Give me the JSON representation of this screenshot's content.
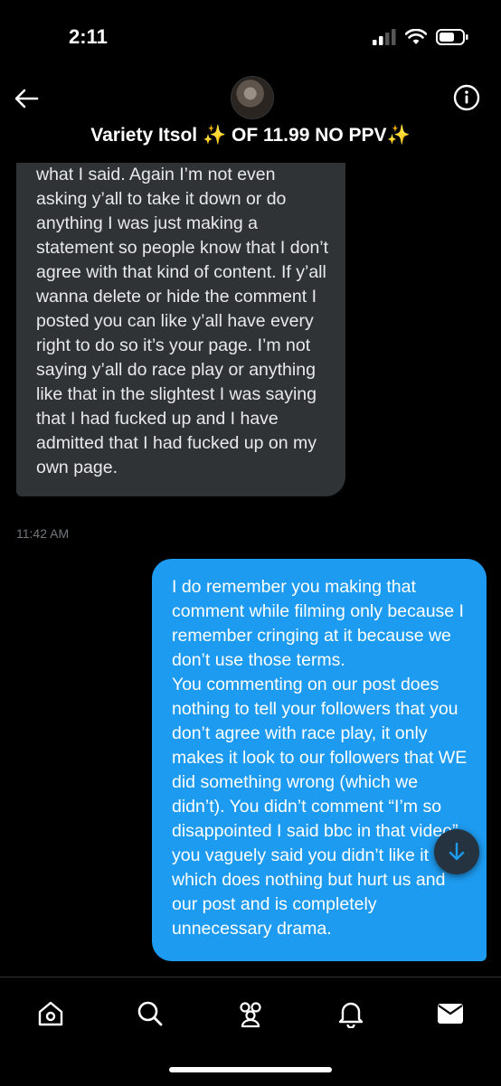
{
  "status_bar": {
    "time": "2:11"
  },
  "header": {
    "title_text": "Variety Itsol",
    "title_sparkle_left": "✨",
    "title_offer": "OF 11.99 NO PPV",
    "title_sparkle_right": "✨",
    "icons": {
      "back": "back-arrow-icon",
      "info": "info-icon"
    }
  },
  "messages": {
    "incoming": {
      "text": "what I said. Again I’m not even asking y’all to take it down or do anything I was just making a statement so people know that I don’t agree with that kind of content. If y’all wanna delete or hide the comment I posted you can like y’all have every right to do so it’s your page. I’m not saying y’all do race play or anything like that in the slightest I was saying that I had fucked up and I have admitted that I had fucked up on my own page.",
      "time": "11:42 AM"
    },
    "outgoing": {
      "paragraph1": "I do remember you making that comment while filming only because I remember cringing at it because we don’t use those terms.",
      "paragraph2": "You commenting on our post does nothing to tell your followers that you don’t agree with race play, it only makes it look to our followers that WE did something wrong (which we didn’t). You didn’t comment “I’m so disappointed I said bbc in that video” you vaguely said you didn’t like it which does nothing but hurt us and our post and is completely unnecessary drama."
    }
  },
  "bottom_nav": {
    "items": [
      "home-icon",
      "search-icon",
      "communities-icon",
      "notifications-icon",
      "messages-icon"
    ]
  },
  "colors": {
    "background": "#000000",
    "incoming_bubble": "#2f3336",
    "outgoing_bubble": "#1d9bf0",
    "muted_text": "#71767b",
    "sparkle": "#f5c518"
  }
}
